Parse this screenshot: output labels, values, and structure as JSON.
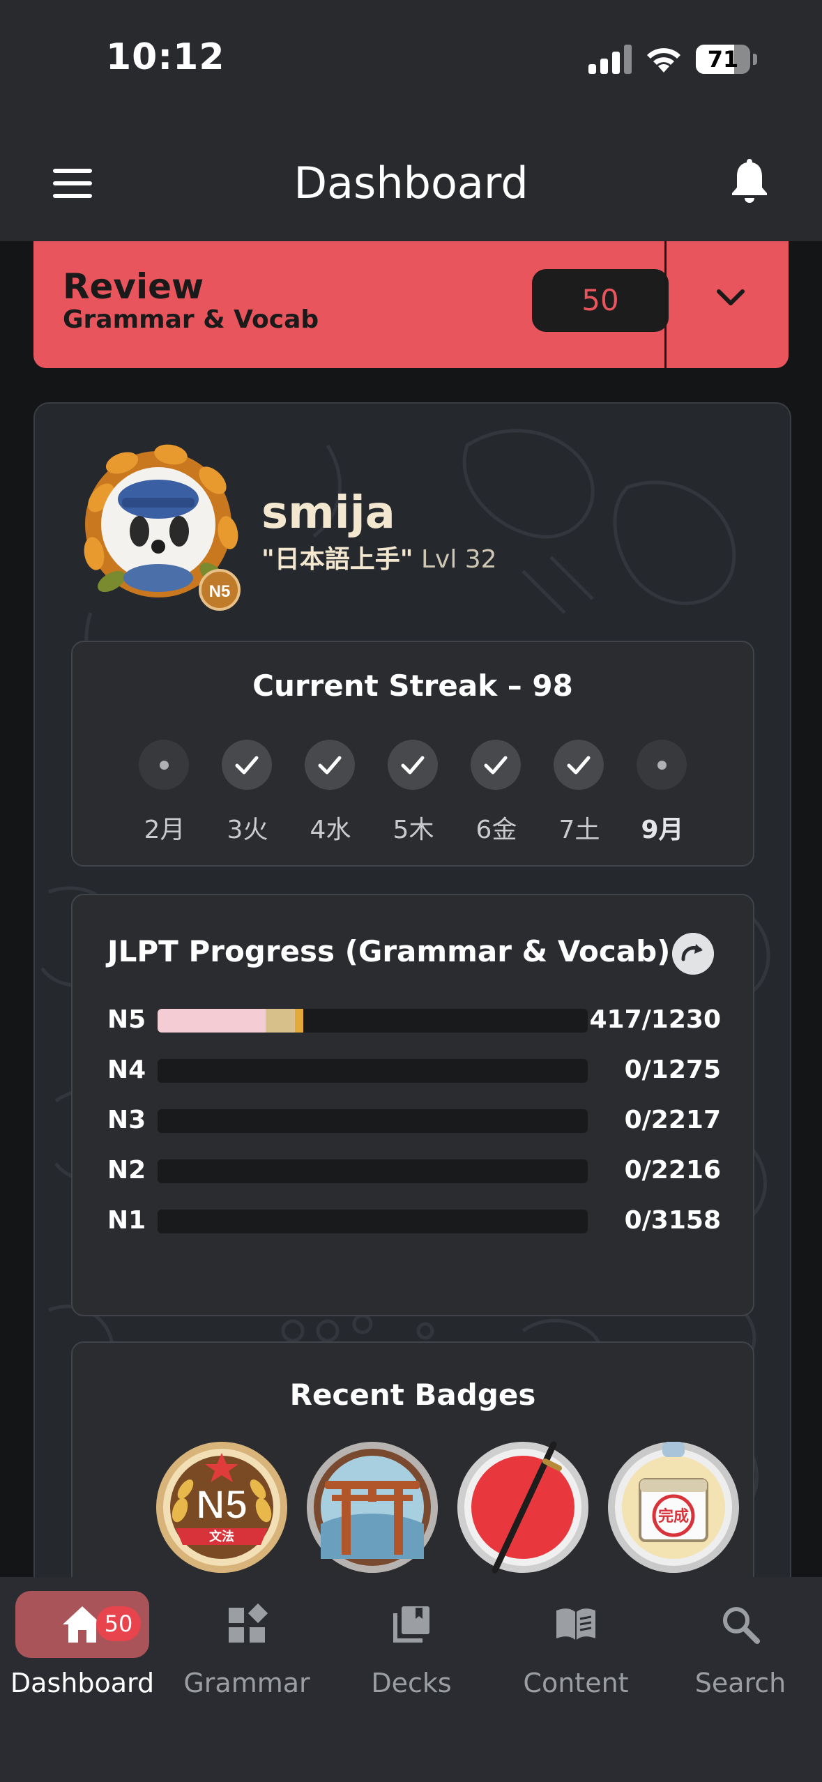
{
  "status_bar": {
    "time": "10:12",
    "battery": "71",
    "battery_level": 0.71
  },
  "app_bar": {
    "title": "Dashboard"
  },
  "review": {
    "title": "Review",
    "subtitle": "Grammar & Vocab",
    "count": "50"
  },
  "profile": {
    "username": "smija",
    "title": "\"日本語上手\"",
    "level": "Lvl 32",
    "avatar_badge": "N5"
  },
  "streak": {
    "title": "Current Streak – 98",
    "days": [
      {
        "label": "2月",
        "done": false
      },
      {
        "label": "3火",
        "done": true
      },
      {
        "label": "4水",
        "done": true
      },
      {
        "label": "5木",
        "done": true
      },
      {
        "label": "6金",
        "done": true
      },
      {
        "label": "7土",
        "done": true
      },
      {
        "label": "9月",
        "done": false
      }
    ]
  },
  "jlpt": {
    "title": "JLPT Progress (Grammar & Vocab)",
    "levels": [
      {
        "label": "N5",
        "count": "417/1230",
        "done": 417,
        "total": 1230
      },
      {
        "label": "N4",
        "count": "0/1275",
        "done": 0,
        "total": 1275
      },
      {
        "label": "N3",
        "count": "0/2217",
        "done": 0,
        "total": 2217
      },
      {
        "label": "N2",
        "count": "0/2216",
        "done": 0,
        "total": 2216
      },
      {
        "label": "N1",
        "count": "0/3158",
        "done": 0,
        "total": 3158
      }
    ],
    "colors": {
      "seg1": "#f3cdd3",
      "seg2": "#d8c08b",
      "seg3": "#e3a93b"
    }
  },
  "badges": {
    "title": "Recent Badges",
    "items": [
      {
        "name": "n5-grammar-badge",
        "text": "N5",
        "subtext": "文法"
      },
      {
        "name": "torii-gate-badge"
      },
      {
        "name": "katana-badge"
      },
      {
        "name": "completion-badge",
        "text": "完成"
      }
    ]
  },
  "nav": {
    "items": [
      {
        "label": "Dashboard",
        "icon": "home-icon",
        "badge": "50",
        "active": true
      },
      {
        "label": "Grammar",
        "icon": "grammar-blocks-icon"
      },
      {
        "label": "Decks",
        "icon": "decks-icon"
      },
      {
        "label": "Content",
        "icon": "book-icon"
      },
      {
        "label": "Search",
        "icon": "search-icon"
      }
    ]
  },
  "colors": {
    "accent": "#e8555d",
    "background": "#141516",
    "bar": "#282a2e"
  }
}
